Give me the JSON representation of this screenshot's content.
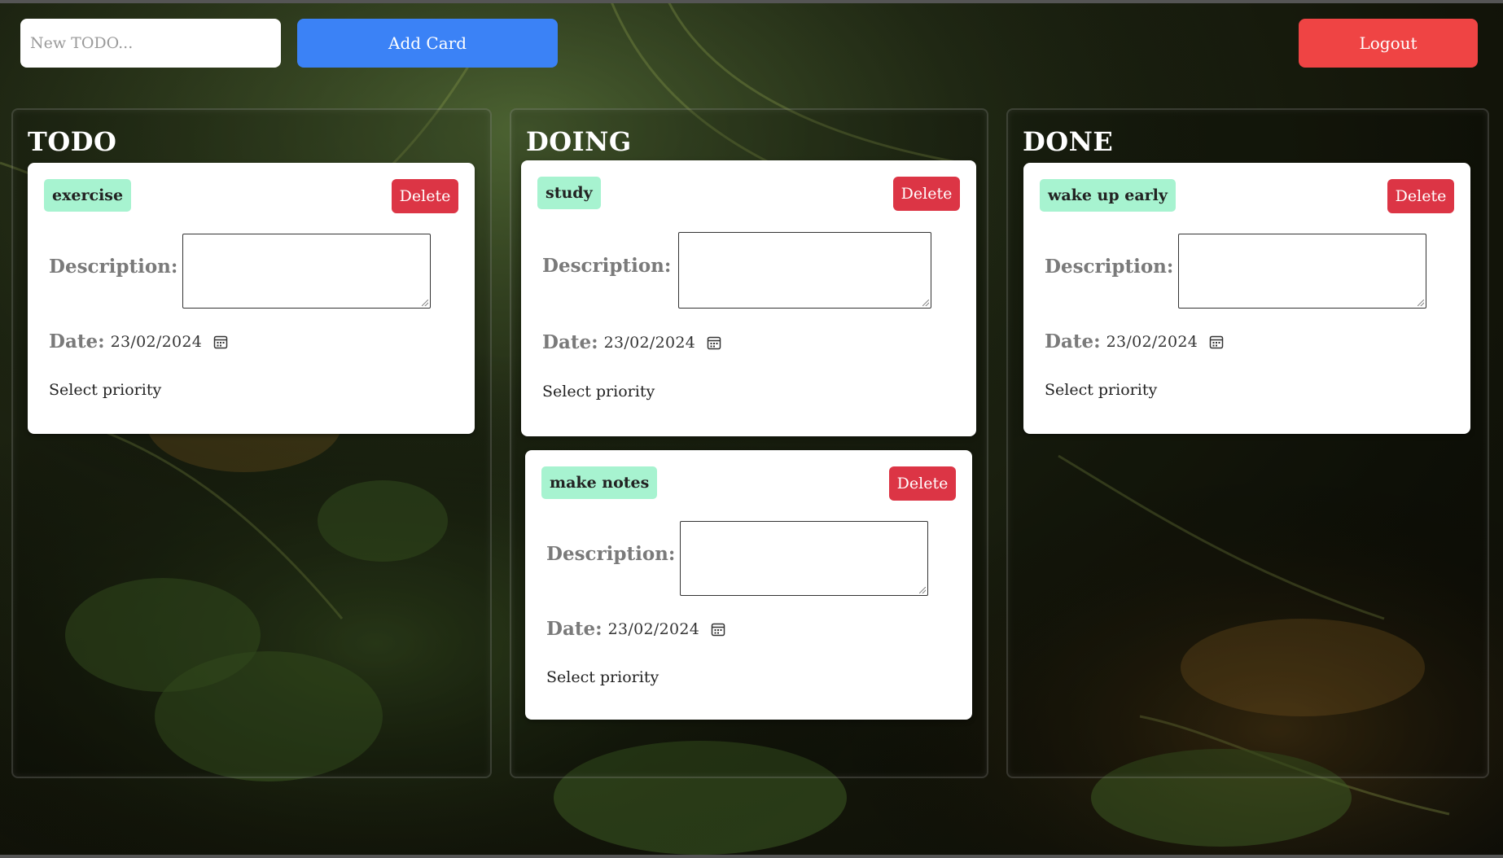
{
  "toolbar": {
    "new_todo_placeholder": "New TODO...",
    "add_card_label": "Add Card",
    "logout_label": "Logout"
  },
  "labels": {
    "delete": "Delete",
    "description": "Description:",
    "date": "Date:",
    "select_priority": "Select priority"
  },
  "colors": {
    "add_button": "#3b82f6",
    "logout_button": "#ef4444",
    "delete_button": "#dc3545",
    "tag_background": "#a7f3d0"
  },
  "columns": [
    {
      "title": "TODO",
      "cards": [
        {
          "name": "exercise",
          "date": "23/02/2024",
          "description": ""
        }
      ]
    },
    {
      "title": "DOING",
      "cards": [
        {
          "name": "study",
          "date": "23/02/2024",
          "description": ""
        },
        {
          "name": "make notes",
          "date": "23/02/2024",
          "description": ""
        }
      ]
    },
    {
      "title": "DONE",
      "cards": [
        {
          "name": "wake up early",
          "date": "23/02/2024",
          "description": ""
        }
      ]
    }
  ],
  "icons": {
    "calendar": "calendar-icon"
  }
}
